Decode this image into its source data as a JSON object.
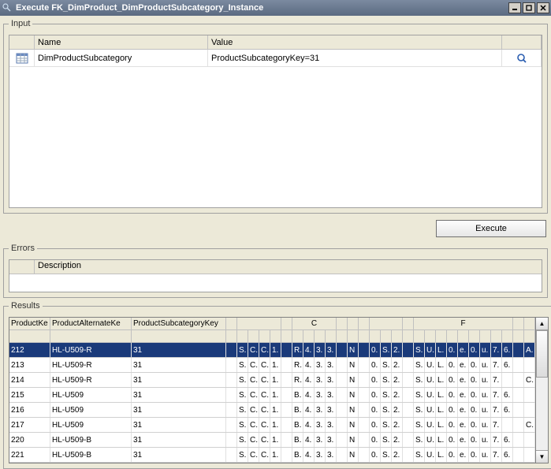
{
  "titlebar": {
    "text": "Execute FK_DimProduct_DimProductSubcategory_Instance"
  },
  "input": {
    "legend": "Input",
    "columns": {
      "name": "Name",
      "value": "Value"
    },
    "row": {
      "name": "DimProductSubcategory",
      "value": "ProductSubcategoryKey=31"
    }
  },
  "execute_label": "Execute",
  "errors": {
    "legend": "Errors",
    "columns": {
      "description": "Description"
    }
  },
  "results": {
    "legend": "Results",
    "columns": {
      "productKey": "ProductKe",
      "productAlternateKey": "ProductAlternateKe",
      "productSubcategoryKey": "ProductSubcategoryKey",
      "groupC": "C",
      "groupF": "F"
    },
    "rows": [
      {
        "pk": "212",
        "alt": "HL-U509-R",
        "sub": "31",
        "a": [
          "S.",
          "C.",
          "C.",
          "1."
        ],
        "b": [
          "R.",
          "4.",
          "3.",
          "3."
        ],
        "c": [
          "N"
        ],
        "d": [
          "0.",
          "S.",
          "2."
        ],
        "e": [
          "S.",
          "U.",
          "L.",
          "0.",
          "e.",
          "0.",
          "u.",
          "7.",
          "6."
        ],
        "f": [
          "A."
        ]
      },
      {
        "pk": "213",
        "alt": "HL-U509-R",
        "sub": "31",
        "a": [
          "S.",
          "C.",
          "C.",
          "1."
        ],
        "b": [
          "R.",
          "4.",
          "3.",
          "3."
        ],
        "c": [
          "N"
        ],
        "d": [
          "0.",
          "S.",
          "2."
        ],
        "e": [
          "S.",
          "U.",
          "L.",
          "0.",
          "e.",
          "0.",
          "u.",
          "7.",
          "6."
        ],
        "f": [
          ""
        ]
      },
      {
        "pk": "214",
        "alt": "HL-U509-R",
        "sub": "31",
        "a": [
          "S.",
          "C.",
          "C.",
          "1."
        ],
        "b": [
          "R.",
          "4.",
          "3.",
          "3."
        ],
        "c": [
          "N"
        ],
        "d": [
          "0.",
          "S.",
          "2."
        ],
        "e": [
          "S.",
          "U.",
          "L.",
          "0.",
          "e.",
          "0.",
          "u.",
          "7."
        ],
        "f": [
          "C."
        ]
      },
      {
        "pk": "215",
        "alt": "HL-U509",
        "sub": "31",
        "a": [
          "S.",
          "C.",
          "C.",
          "1."
        ],
        "b": [
          "B.",
          "4.",
          "3.",
          "3."
        ],
        "c": [
          "N"
        ],
        "d": [
          "0.",
          "S.",
          "2."
        ],
        "e": [
          "S.",
          "U.",
          "L.",
          "0.",
          "e.",
          "0.",
          "u.",
          "7.",
          "6."
        ],
        "f": [
          ""
        ]
      },
      {
        "pk": "216",
        "alt": "HL-U509",
        "sub": "31",
        "a": [
          "S.",
          "C.",
          "C.",
          "1."
        ],
        "b": [
          "B.",
          "4.",
          "3.",
          "3."
        ],
        "c": [
          "N"
        ],
        "d": [
          "0.",
          "S.",
          "2."
        ],
        "e": [
          "S.",
          "U.",
          "L.",
          "0.",
          "e.",
          "0.",
          "u.",
          "7.",
          "6."
        ],
        "f": [
          ""
        ]
      },
      {
        "pk": "217",
        "alt": "HL-U509",
        "sub": "31",
        "a": [
          "S.",
          "C.",
          "C.",
          "1."
        ],
        "b": [
          "B.",
          "4.",
          "3.",
          "3."
        ],
        "c": [
          "N"
        ],
        "d": [
          "0.",
          "S.",
          "2."
        ],
        "e": [
          "S.",
          "U.",
          "L.",
          "0.",
          "e.",
          "0.",
          "u.",
          "7."
        ],
        "f": [
          "C."
        ]
      },
      {
        "pk": "220",
        "alt": "HL-U509-B",
        "sub": "31",
        "a": [
          "S.",
          "C.",
          "C.",
          "1."
        ],
        "b": [
          "B.",
          "4.",
          "3.",
          "3."
        ],
        "c": [
          "N"
        ],
        "d": [
          "0.",
          "S.",
          "2."
        ],
        "e": [
          "S.",
          "U.",
          "L.",
          "0.",
          "e.",
          "0.",
          "u.",
          "7.",
          "6."
        ],
        "f": [
          ""
        ]
      },
      {
        "pk": "221",
        "alt": "HL-U509-B",
        "sub": "31",
        "a": [
          "S.",
          "C.",
          "C.",
          "1."
        ],
        "b": [
          "B.",
          "4.",
          "3.",
          "3."
        ],
        "c": [
          "N"
        ],
        "d": [
          "0.",
          "S.",
          "2."
        ],
        "e": [
          "S.",
          "U.",
          "L.",
          "0.",
          "e.",
          "0.",
          "u.",
          "7.",
          "6."
        ],
        "f": [
          ""
        ]
      }
    ]
  }
}
